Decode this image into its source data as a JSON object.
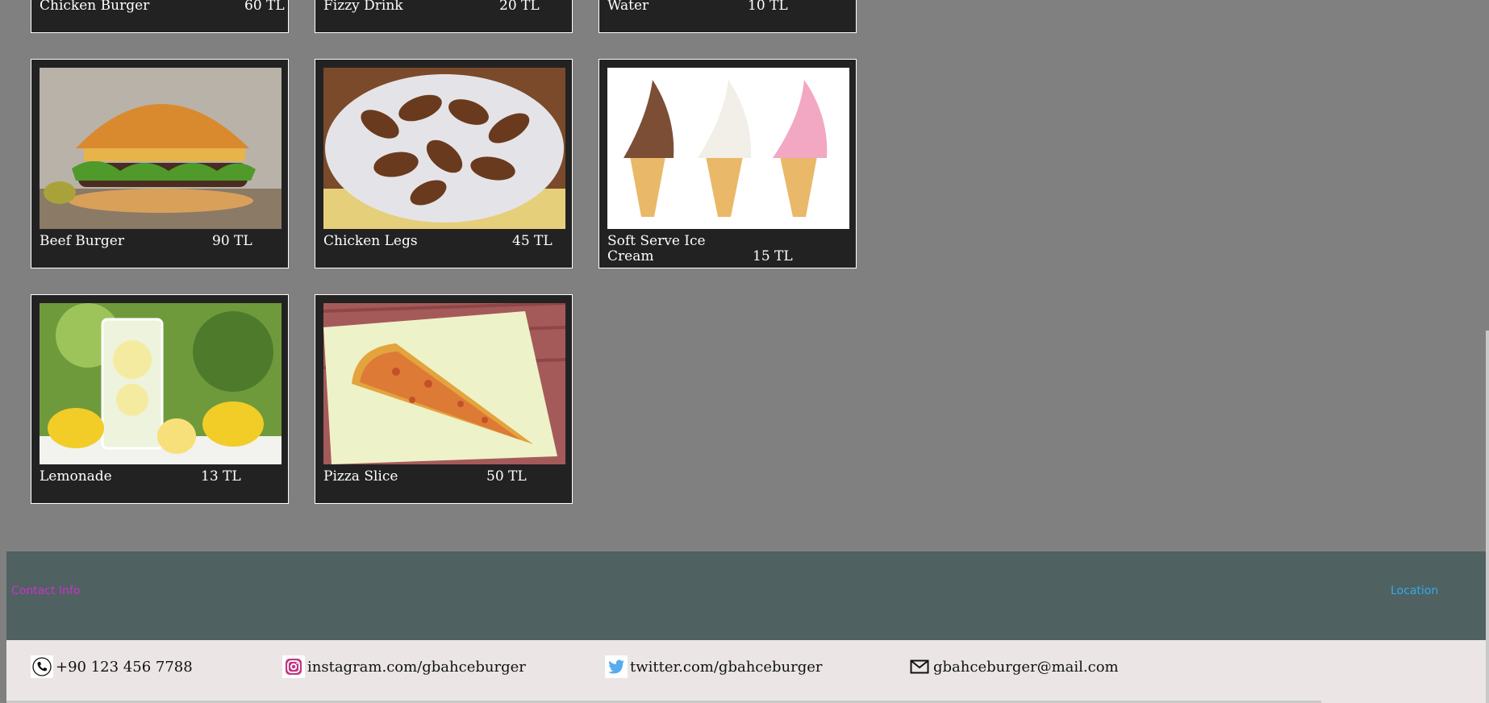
{
  "menu": {
    "top_row": [
      {
        "name": "Chicken Burger",
        "price": "60 TL"
      },
      {
        "name": "Fizzy Drink",
        "price": "20 TL"
      },
      {
        "name": "Water",
        "price": "10 TL"
      }
    ],
    "items": [
      {
        "name": "Beef Burger",
        "price": "90 TL",
        "image": "beef-burger-photo"
      },
      {
        "name": "Chicken Legs",
        "price": "45 TL",
        "image": "chicken-legs-photo"
      },
      {
        "name": "Soft Serve Ice Cream",
        "price": "15 TL",
        "image": "ice-cream-photo"
      },
      {
        "name": "Lemonade",
        "price": "13 TL",
        "image": "lemonade-photo"
      },
      {
        "name": "Pizza Slice",
        "price": "50 TL",
        "image": "pizza-slice-photo"
      }
    ]
  },
  "footer": {
    "contact_title": "Contact Info",
    "location_label": "Location",
    "contacts": [
      {
        "icon": "phone-icon",
        "text": "+90 123 456 7788"
      },
      {
        "icon": "instagram-icon",
        "text": "instagram.com/gbahceburger"
      },
      {
        "icon": "twitter-icon",
        "text": "twitter.com/gbahceburger"
      },
      {
        "icon": "mail-icon",
        "text": "gbahceburger@mail.com"
      }
    ]
  },
  "colors": {
    "page_bg": "#808080",
    "card_bg": "#222222",
    "footer_top_bg": "#4f6161",
    "footer_bottom_bg": "#ebe6e5",
    "contact_title": "#cc33cc",
    "location_link": "#33aaee"
  }
}
